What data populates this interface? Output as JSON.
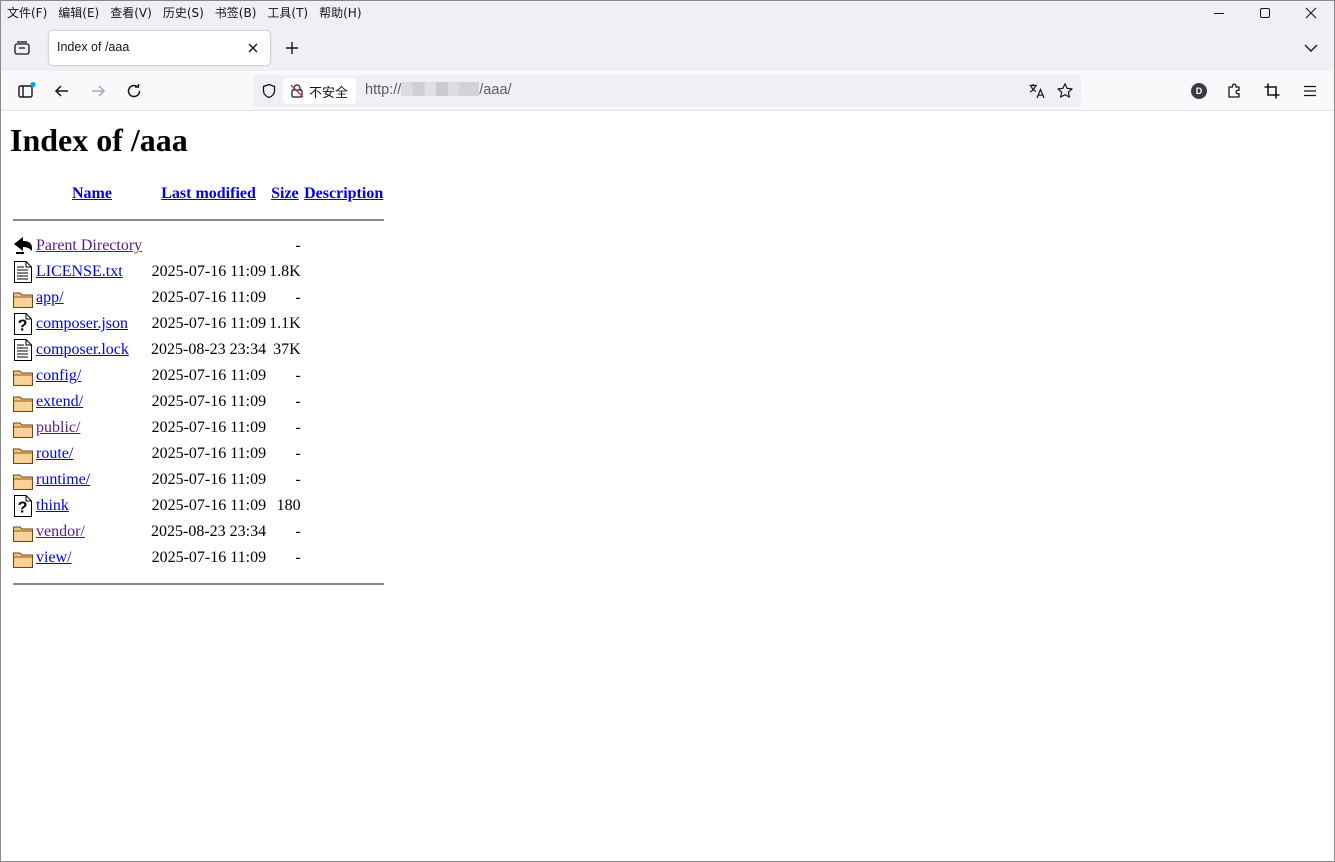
{
  "menu": [
    "文件(F)",
    "编辑(E)",
    "查看(V)",
    "历史(S)",
    "书签(B)",
    "工具(T)",
    "帮助(H)"
  ],
  "tab": {
    "title": "Index of /aaa"
  },
  "urlbar": {
    "security_label": "不安全",
    "url_prefix": "http://",
    "url_suffix": "/aaa/"
  },
  "account_initial": "D",
  "page": {
    "heading": "Index of /aaa",
    "columns": {
      "name": "Name",
      "modified": "Last modified",
      "size": "Size",
      "description": "Description"
    },
    "entries": [
      {
        "icon": "back-icon",
        "name": "Parent Directory",
        "modified": "",
        "size": "-",
        "visited": true
      },
      {
        "icon": "text-file-icon",
        "name": "LICENSE.txt",
        "modified": "2025-07-16 11:09",
        "size": "1.8K",
        "visited": false
      },
      {
        "icon": "folder-icon",
        "name": "app/",
        "modified": "2025-07-16 11:09",
        "size": "-",
        "visited": false
      },
      {
        "icon": "unknown-file-icon",
        "name": "composer.json",
        "modified": "2025-07-16 11:09",
        "size": "1.1K",
        "visited": false
      },
      {
        "icon": "text-file-icon",
        "name": "composer.lock",
        "modified": "2025-08-23 23:34",
        "size": "37K",
        "visited": false
      },
      {
        "icon": "folder-icon",
        "name": "config/",
        "modified": "2025-07-16 11:09",
        "size": "-",
        "visited": false
      },
      {
        "icon": "folder-icon",
        "name": "extend/",
        "modified": "2025-07-16 11:09",
        "size": "-",
        "visited": false
      },
      {
        "icon": "folder-icon",
        "name": "public/",
        "modified": "2025-07-16 11:09",
        "size": "-",
        "visited": true
      },
      {
        "icon": "folder-icon",
        "name": "route/",
        "modified": "2025-07-16 11:09",
        "size": "-",
        "visited": false
      },
      {
        "icon": "folder-icon",
        "name": "runtime/",
        "modified": "2025-07-16 11:09",
        "size": "-",
        "visited": false
      },
      {
        "icon": "unknown-file-icon",
        "name": "think",
        "modified": "2025-07-16 11:09",
        "size": "180",
        "visited": false
      },
      {
        "icon": "folder-icon",
        "name": "vendor/",
        "modified": "2025-08-23 23:34",
        "size": "-",
        "visited": true
      },
      {
        "icon": "folder-icon",
        "name": "view/",
        "modified": "2025-07-16 11:09",
        "size": "-",
        "visited": false
      }
    ]
  }
}
